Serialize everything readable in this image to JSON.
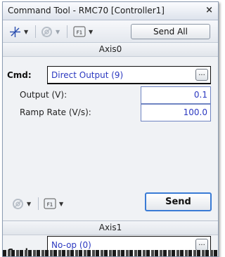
{
  "window": {
    "title": "Command Tool - RMC70 [Controller1]",
    "close_glyph": "×"
  },
  "toolbar": {
    "tool1_icon": "axis-cross-icon",
    "tool2_icon": "disabled-gear-icon",
    "tool3_icon": "function-key-icon",
    "tool3_glyph": "F1",
    "send_all_label": "Send All"
  },
  "axis0": {
    "header": "Axis0",
    "cmd_label": "Cmd:",
    "cmd_value": "Direct Output (9)",
    "ellipsis": "...",
    "params": [
      {
        "label": "Output (V):",
        "value": "0.1"
      },
      {
        "label": "Ramp Rate (V/s):",
        "value": "100.0"
      }
    ],
    "tool1_icon": "disabled-gear-icon",
    "tool2_icon": "function-key-icon",
    "tool2_glyph": "F1",
    "send_label": "Send"
  },
  "axis1": {
    "header": "Axis1",
    "cmd_label": "Cmd:",
    "cmd_value": "No-op (0)",
    "ellipsis": "..."
  },
  "colors": {
    "value_text": "#2b38c0",
    "panel_bg": "#f0f2f5",
    "toolbar_bg": "#e4e8ee",
    "send_border": "#3a7bd5"
  }
}
